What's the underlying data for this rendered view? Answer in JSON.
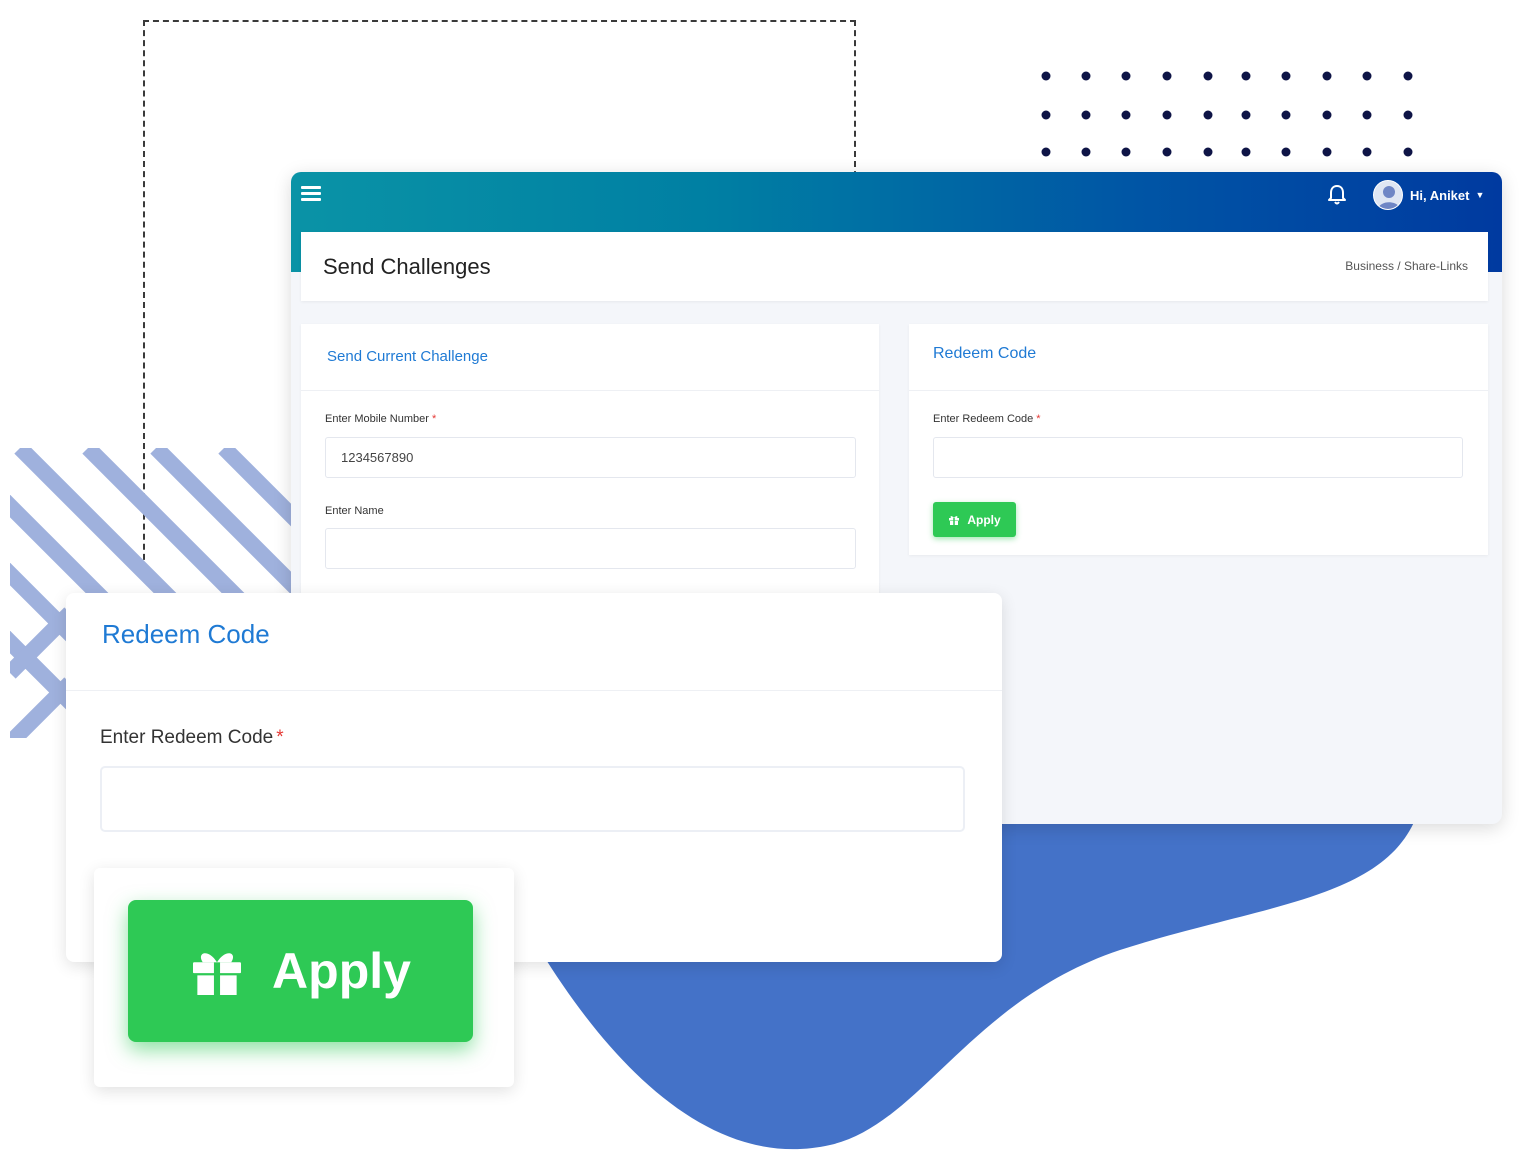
{
  "header": {
    "user_greeting": "Hi, Aniket"
  },
  "page": {
    "title": "Send Challenges",
    "breadcrumb": "Business / Share-Links"
  },
  "send_challenge": {
    "title": "Send Current Challenge",
    "mobile_label": "Enter Mobile Number",
    "mobile_value": "1234567890",
    "name_label": "Enter Name",
    "name_value": ""
  },
  "redeem": {
    "title": "Redeem Code",
    "code_label": "Enter Redeem Code",
    "code_value": "",
    "apply_label": "Apply"
  },
  "required_marker": "*",
  "colors": {
    "topbar_start": "#0a93a6",
    "topbar_end": "#003aa0",
    "accent_blue": "#1f7ad4",
    "apply_green": "#2ec955",
    "blob_blue": "#4472c8",
    "required_red": "#e53935"
  },
  "icons": [
    "hamburger-menu-icon",
    "bell-icon",
    "avatar-icon",
    "caret-down-icon",
    "gift-icon"
  ]
}
